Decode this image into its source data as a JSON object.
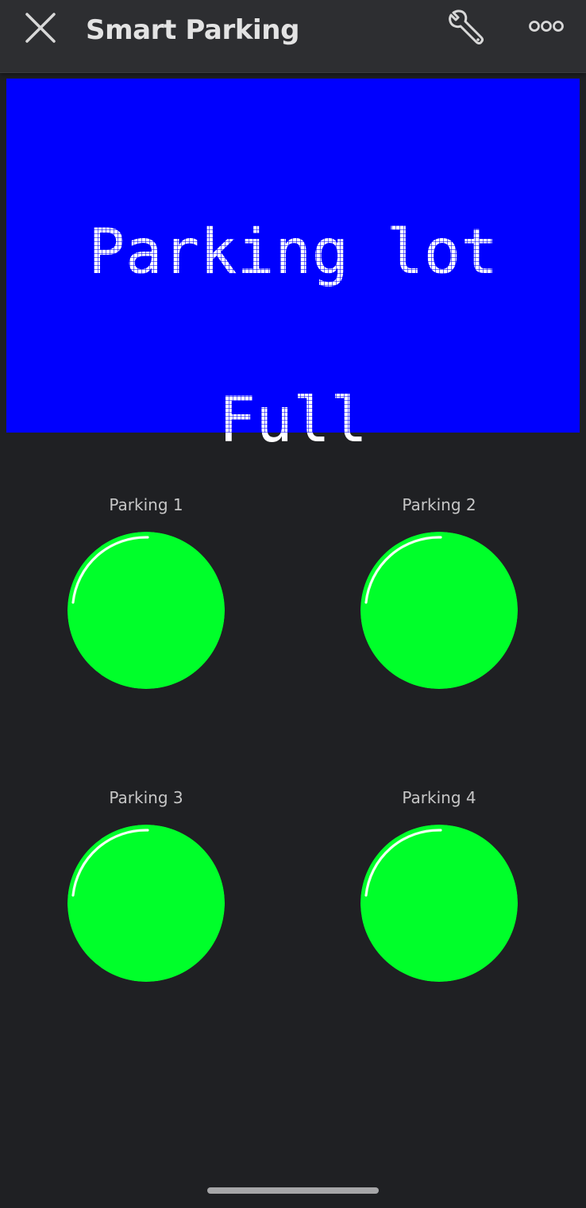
{
  "app_bar": {
    "title": "Smart Parking",
    "close_icon": "close-icon",
    "settings_icon": "wrench-icon",
    "more_icon": "more-horizontal-icon"
  },
  "lcd": {
    "line1": "Parking lot",
    "line2": "Full",
    "background_color": "#0000fe",
    "text_color": "#ffffff"
  },
  "leds": [
    {
      "label": "Parking 1",
      "color": "#00ff2a",
      "state": "on"
    },
    {
      "label": "Parking 2",
      "color": "#00ff2a",
      "state": "on"
    },
    {
      "label": "Parking 3",
      "color": "#00ff2a",
      "state": "on"
    },
    {
      "label": "Parking 4",
      "color": "#00ff2a",
      "state": "on"
    }
  ],
  "theme": {
    "background": "#1f2023",
    "app_bar": "#2d2e31"
  }
}
